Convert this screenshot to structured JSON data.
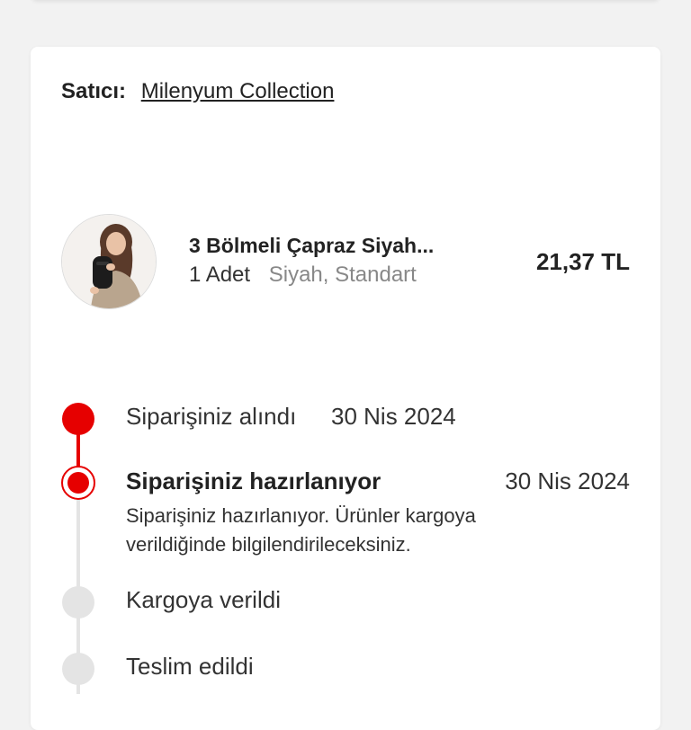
{
  "seller": {
    "label": "Satıcı:",
    "name": "Milenyum Collection"
  },
  "product": {
    "title": "3 Bölmeli Çapraz Siyah...",
    "quantity": "1 Adet",
    "variant": "Siyah, Standart",
    "price": "21,37 TL",
    "image_icon": "product-photo"
  },
  "timeline": {
    "accent_color": "#e60000",
    "pending_color": "#e4e4e4",
    "steps": [
      {
        "title": "Siparişiniz alındı",
        "date": "30 Nis 2024",
        "state": "done"
      },
      {
        "title": "Siparişiniz hazırlanıyor",
        "date": "30 Nis 2024",
        "state": "active",
        "description": "Siparişiniz hazırlanıyor. Ürünler kargoya verildiğinde bilgilendirileceksiniz."
      },
      {
        "title": "Kargoya verildi",
        "state": "pending"
      },
      {
        "title": "Teslim edildi",
        "state": "pending"
      }
    ]
  }
}
